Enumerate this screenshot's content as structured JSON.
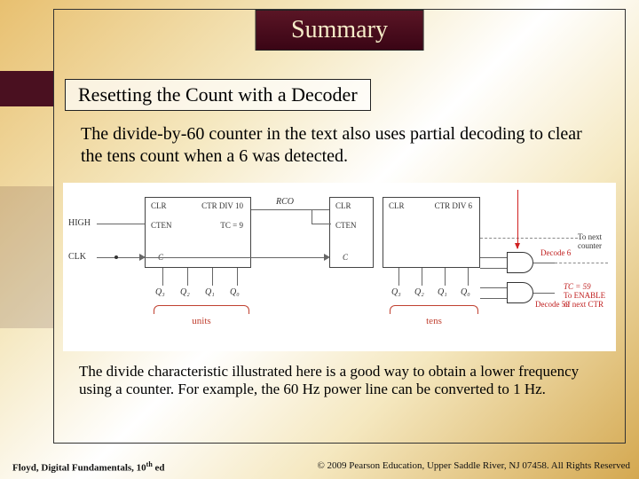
{
  "title": "Summary",
  "subtitle": "Resetting the Count with a Decoder",
  "body1": "The divide-by-60 counter in the text also uses partial decoding to clear the tens count when a 6 was detected.",
  "body2": "The divide characteristic illustrated here is a good way to obtain a lower frequency using a counter. For example, the 60 Hz power line can be converted to 1 Hz.",
  "footer": {
    "left_author": "Floyd, Digital Fundamentals, 10",
    "left_sup": "th",
    "left_suffix": " ed",
    "right": "© 2009 Pearson Education, Upper Saddle River, NJ 07458. All Rights Reserved"
  },
  "diagram": {
    "inputs": {
      "high": "HIGH",
      "clk": "CLK"
    },
    "block1": {
      "clr": "CLR",
      "div": "CTR DIV 10",
      "cten": "CTEN",
      "tc": "TC = 9",
      "c": "C"
    },
    "rco": "RCO",
    "block2": {
      "clr": "CLR",
      "div": "CTR DIV 6",
      "cten": "CTEN",
      "c": "C"
    },
    "outputs": {
      "q": [
        "Q₀",
        "Q₁",
        "Q₂",
        "Q₃"
      ],
      "units": "units",
      "tens": "tens",
      "decode6": "Decode 6",
      "decode59": "Decode 59",
      "tc59a": "TC = 59",
      "tc59b": "To ENABLE",
      "tc59c": "of next CTR",
      "tonext": "To next",
      "tonext2": "counter"
    }
  }
}
